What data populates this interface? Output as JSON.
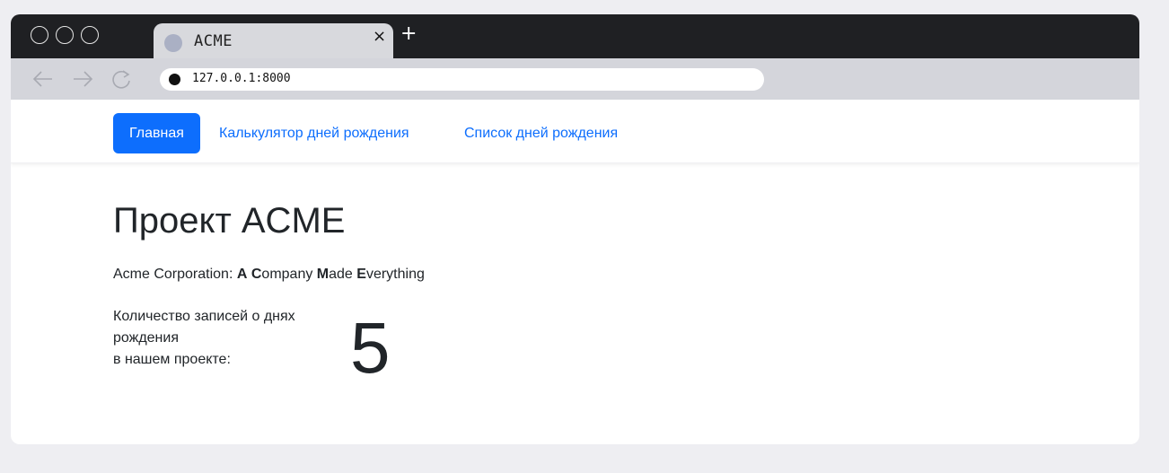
{
  "browser": {
    "tab_title": "ACME",
    "tab_close": "×",
    "new_tab": "+",
    "url": "127.0.0.1:8000"
  },
  "navbar": {
    "items": [
      {
        "label": "Главная",
        "active": true
      },
      {
        "label": "Калькулятор дней рождения",
        "active": false
      },
      {
        "label": "Список дней рождения",
        "active": false
      }
    ]
  },
  "main": {
    "title": "Проект ACME",
    "subtitle": {
      "prefix": "Acme Corporation: ",
      "parts": [
        {
          "bold": "A",
          "rest": " "
        },
        {
          "bold": "C",
          "rest": "ompany "
        },
        {
          "bold": "M",
          "rest": "ade "
        },
        {
          "bold": "E",
          "rest": "verything"
        }
      ]
    },
    "count_label_line1": "Количество записей о днях рождения",
    "count_label_line2": "в нашем проекте:",
    "count_value": "5"
  },
  "colors": {
    "accent": "#0d6efd",
    "titlebar": "#1f2023",
    "toolbar": "#d4d5db"
  }
}
